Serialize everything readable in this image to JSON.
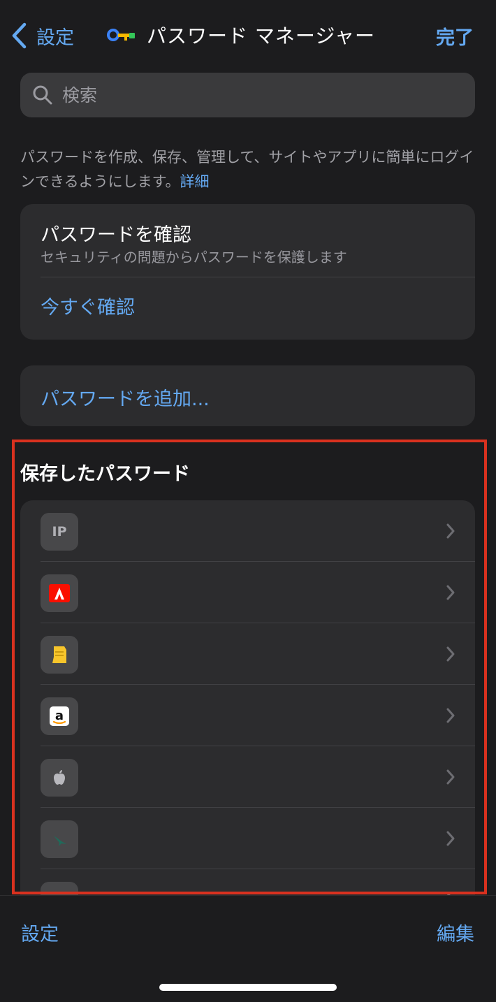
{
  "nav": {
    "back_label": "設定",
    "title": "パスワード マネージャー",
    "done_label": "完了"
  },
  "search": {
    "placeholder": "検索"
  },
  "description": {
    "text": "パスワードを作成、保存、管理して、サイトやアプリに簡単にログインできるようにします。",
    "link": "詳細"
  },
  "security_check": {
    "title": "パスワードを確認",
    "subtitle": "セキュリティの問題からパスワードを保護します",
    "action": "今すぐ確認"
  },
  "add_password": {
    "label": "パスワードを追加..."
  },
  "saved_passwords": {
    "heading": "保存したパスワード",
    "items": [
      {
        "icon": "ip-monogram-icon",
        "monogram": "IP"
      },
      {
        "icon": "adobe-icon"
      },
      {
        "icon": "yellow-app-icon"
      },
      {
        "icon": "amazon-icon"
      },
      {
        "icon": "apple-icon"
      },
      {
        "icon": "bird-app-icon"
      },
      {
        "icon": "partial-app-icon"
      }
    ]
  },
  "toolbar": {
    "left_label": "設定",
    "right_label": "編集"
  },
  "colors": {
    "accent": "#64a9f2",
    "background": "#1c1c1e",
    "card": "#2c2c2e",
    "highlight_border": "#d9311f"
  }
}
